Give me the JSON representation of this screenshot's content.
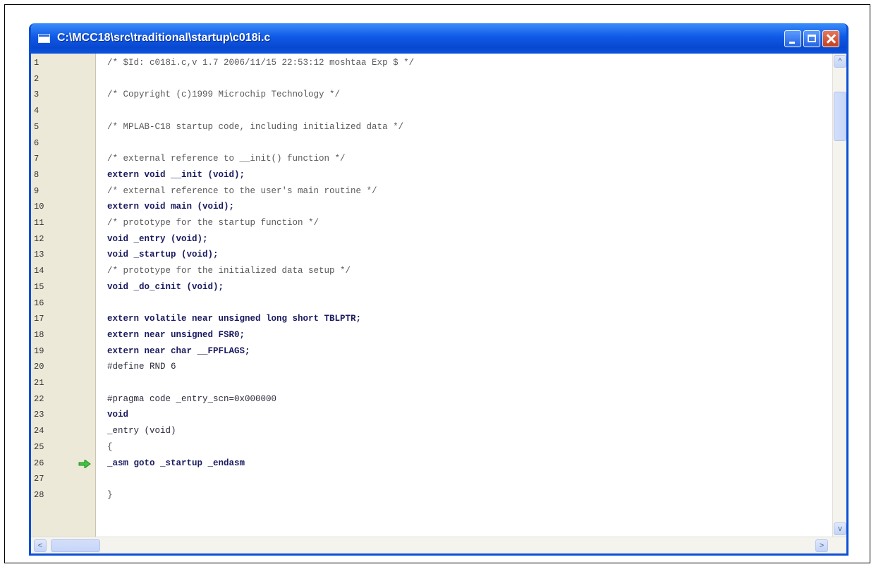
{
  "window": {
    "title": "C:\\MCC18\\src\\traditional\\startup\\c018i.c",
    "accent": "#0a4fd6"
  },
  "editor": {
    "current_line_marker": "green-arrow-icon",
    "marker_line": 26,
    "lines": [
      {
        "n": "1",
        "text": "/* $Id: c018i.c,v 1.7 2006/11/15 22:53:12 moshtaa Exp $ */",
        "kind": "cm"
      },
      {
        "n": "2",
        "text": "",
        "kind": "cm"
      },
      {
        "n": "3",
        "text": "/* Copyright (c)1999 Microchip Technology */",
        "kind": "cm"
      },
      {
        "n": "4",
        "text": "",
        "kind": "cm"
      },
      {
        "n": "5",
        "text": "/* MPLAB-C18 startup code, including initialized data */",
        "kind": "cm"
      },
      {
        "n": "6",
        "text": "",
        "kind": "cm"
      },
      {
        "n": "7",
        "text": "/* external reference to __init() function */",
        "kind": "cm"
      },
      {
        "n": "8",
        "text": "extern void __init (void);",
        "kind": "kw"
      },
      {
        "n": "9",
        "text": "/* external reference to the user's main routine */",
        "kind": "cm"
      },
      {
        "n": "10",
        "text": "extern void main (void);",
        "kind": "kw"
      },
      {
        "n": "11",
        "text": "/* prototype for the startup function */",
        "kind": "cm"
      },
      {
        "n": "12",
        "text": "void _entry (void);",
        "kind": "kw"
      },
      {
        "n": "13",
        "text": "void _startup (void);",
        "kind": "kw"
      },
      {
        "n": "14",
        "text": "/* prototype for the initialized data setup */",
        "kind": "cm"
      },
      {
        "n": "15",
        "text": "void _do_cinit (void);",
        "kind": "kw"
      },
      {
        "n": "16",
        "text": "",
        "kind": "cm"
      },
      {
        "n": "17",
        "text": "extern volatile near unsigned long short TBLPTR;",
        "kind": "kw"
      },
      {
        "n": "18",
        "text": "extern near unsigned FSR0;",
        "kind": "kw"
      },
      {
        "n": "19",
        "text": "extern near char __FPFLAGS;",
        "kind": "kw"
      },
      {
        "n": "20",
        "text": "#define RND 6",
        "kind": "pp"
      },
      {
        "n": "21",
        "text": "",
        "kind": "cm"
      },
      {
        "n": "22",
        "text": "#pragma code _entry_scn=0x000000",
        "kind": "pp"
      },
      {
        "n": "23",
        "text": "void",
        "kind": "kw"
      },
      {
        "n": "24",
        "text": "_entry (void)",
        "kind": "pp"
      },
      {
        "n": "25",
        "text": "{",
        "kind": "cm"
      },
      {
        "n": "26",
        "text": "_asm goto _startup _endasm",
        "kind": "kw"
      },
      {
        "n": "27",
        "text": "",
        "kind": "cm"
      },
      {
        "n": "28",
        "text": "}",
        "kind": "cm"
      }
    ]
  },
  "scroll": {
    "up": "^",
    "down": "v",
    "left": "<",
    "right": ">"
  }
}
